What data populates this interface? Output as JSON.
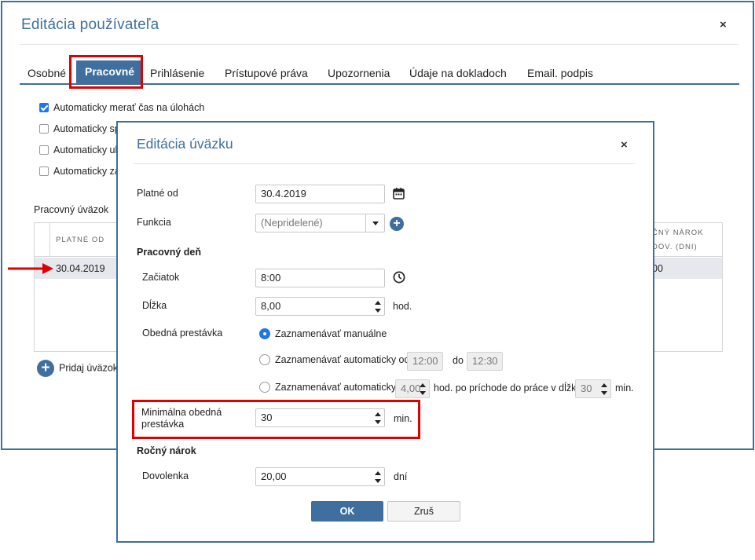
{
  "outer_dialog": {
    "title": "Editácia používateľa",
    "close_label": "×",
    "tabs": [
      {
        "label": "Osobné"
      },
      {
        "label": "Pracovné",
        "active": true
      },
      {
        "label": "Prihlásenie"
      },
      {
        "label": "Prístupové práva"
      },
      {
        "label": "Upozornenia"
      },
      {
        "label": "Údaje na dokladoch"
      },
      {
        "label": "Email. podpis"
      }
    ],
    "checkboxes": [
      {
        "label": "Automaticky merať čas na úlohách",
        "checked": true
      },
      {
        "label": "Automaticky sp",
        "checked": false
      },
      {
        "label": "Automaticky uk",
        "checked": false
      },
      {
        "label": "Automaticky za",
        "checked": false
      }
    ],
    "workload_section_label": "Pracovný úväzok",
    "grid": {
      "col_platne_od": "PLATNÉ OD",
      "col_rocny_narok_1": "ČNÝ NÁROK",
      "col_rocny_narok_2": "DOV. (DNI)",
      "row": {
        "platne_od": "30.04.2019",
        "narok": "00"
      }
    },
    "add_workload_label": "Pridaj úväzok"
  },
  "inner_dialog": {
    "title": "Editácia úväzku",
    "close_label": "×",
    "platne_od": {
      "label": "Platné od",
      "value": "30.4.2019"
    },
    "funkcia": {
      "label": "Funkcia",
      "value": "(Nepridelené)"
    },
    "pracovny_den_heading": "Pracovný deň",
    "zaciatok": {
      "label": "Začiatok",
      "value": "8:00"
    },
    "dlzka": {
      "label": "Dĺžka",
      "value": "8,00",
      "unit": "hod."
    },
    "obedna_prestavka": {
      "label": "Obedná prestávka",
      "option_manual": "Zaznamenávať manuálne",
      "option_auto_from": "Zaznamenávať automaticky od",
      "from_value": "12:00",
      "to_label": "do",
      "to_value": "12:30",
      "option_auto": "Zaznamenávať automaticky",
      "auto_hours_value": "4,00",
      "auto_text": "hod. po príchode do práce v dĺžke",
      "auto_minutes_value": "30",
      "auto_minutes_unit": "min."
    },
    "minimalna_prestavka": {
      "label": "Minimálna obedná prestávka",
      "value": "30",
      "unit": "min."
    },
    "rocny_narok_heading": "Ročný nárok",
    "dovolenka": {
      "label": "Dovolenka",
      "value": "20,00",
      "unit": "dní"
    },
    "ok_label": "OK",
    "cancel_label": "Zruš"
  },
  "colors": {
    "accent": "#3e6f9e",
    "highlight": "#e00000",
    "checkbox": "#1f76e8"
  }
}
